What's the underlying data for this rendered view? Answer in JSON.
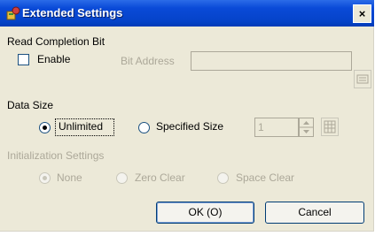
{
  "window": {
    "title": "Extended Settings",
    "close_glyph": "×"
  },
  "read_completion": {
    "group_label": "Read Completion Bit",
    "enable_label": "Enable",
    "enable_checked": false,
    "bit_address_label": "Bit Address",
    "bit_address_value": ""
  },
  "data_size": {
    "group_label": "Data Size",
    "unlimited_label": "Unlimited",
    "specified_label": "Specified Size",
    "selected": "Unlimited",
    "size_value": "1"
  },
  "initialization": {
    "group_label": "Initialization Settings",
    "none_label": "None",
    "zero_clear_label": "Zero Clear",
    "space_clear_label": "Space Clear",
    "selected": "None"
  },
  "buttons": {
    "ok_label": "OK (O)",
    "cancel_label": "Cancel"
  },
  "colors": {
    "titlebar": "#0a4ad8",
    "dialog_bg": "#ece9d8",
    "disabled_text": "#aca899"
  }
}
